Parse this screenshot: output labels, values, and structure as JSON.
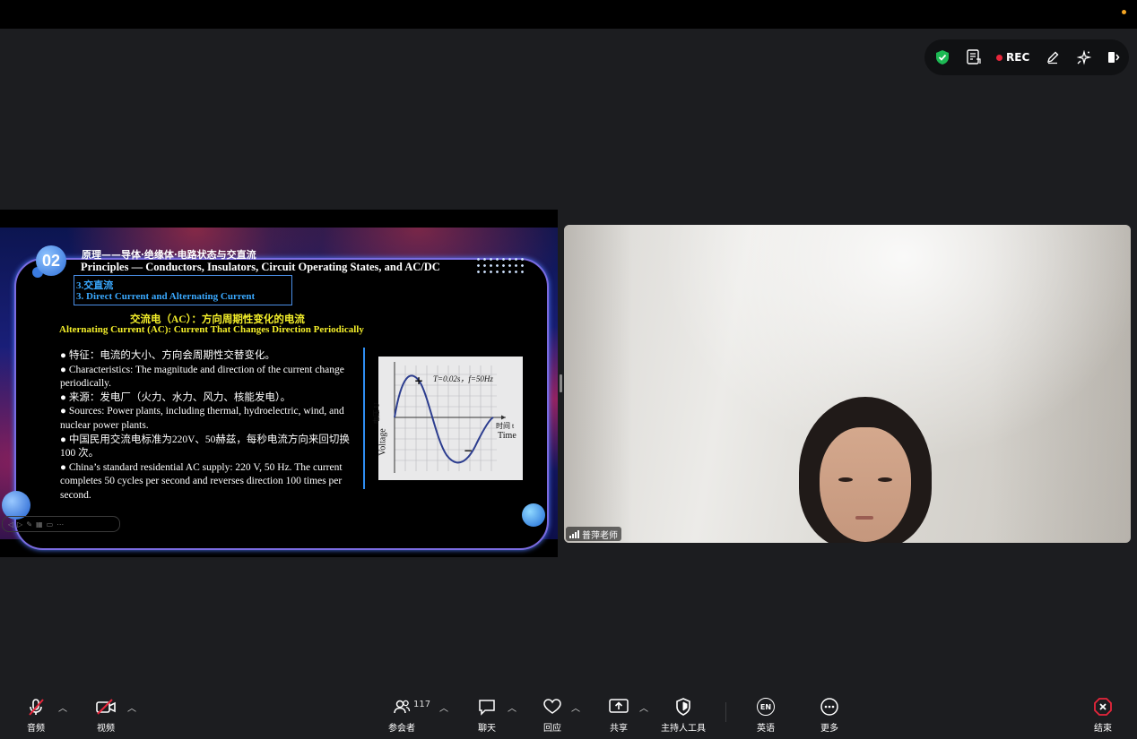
{
  "topbar": {
    "indicator_color": "#f5a623"
  },
  "toolbar": {
    "rec_label": "REC",
    "icons": [
      "shield-check-icon",
      "transcript-icon",
      "record-icon",
      "pen-annotate-icon",
      "ai-sparkle-icon",
      "exit-panel-icon"
    ]
  },
  "slide": {
    "badge_number": "02",
    "title_cn": "原理——导体·绝缘体·电路状态与交直流",
    "title_en": "Principles — Conductors, Insulators, Circuit Operating States, and AC/DC",
    "section_cn": "3.交直流",
    "section_en": "3. Direct Current and Alternating Current",
    "heading_cn": "交流电（AC）：方向周期性变化的电流",
    "heading_en": "Alternating Current (AC): Current That Changes Direction Periodically",
    "bullets": [
      "● 特征：电流的大小、方向会周期性交替变化。",
      "● Characteristics: The magnitude and direction of the current change periodically.",
      "● 来源：发电厂（火力、水力、风力、核能发电）。",
      "● Sources: Power plants, including thermal, hydroelectric, wind, and nuclear power plants.",
      "● 中国民用交流电标准为220V、50赫兹，每秒电流方向来回切换 100 次。",
      "● China’s standard residential AC supply: 220 V, 50 Hz. The current completes 50 cycles per second and reverses direction 100 times per second."
    ],
    "figure": {
      "params": "T=0.02s，f=50Hz",
      "plus": "+",
      "minus": "−",
      "ylabel_cn": "电压 U",
      "ylabel_en": "Voltage",
      "xlabel_cn": "时间 t",
      "xlabel_en": "Time"
    }
  },
  "video": {
    "participant_name": "普萍老师"
  },
  "bottombar": {
    "audio": "音频",
    "video": "视频",
    "participants": "参会者",
    "participants_count": "117",
    "chat": "聊天",
    "reactions": "回应",
    "share": "共享",
    "host_tools": "主持人工具",
    "language": "英语",
    "language_badge": "EN",
    "more": "更多",
    "end": "结束",
    "end_color": "#e8263b"
  }
}
